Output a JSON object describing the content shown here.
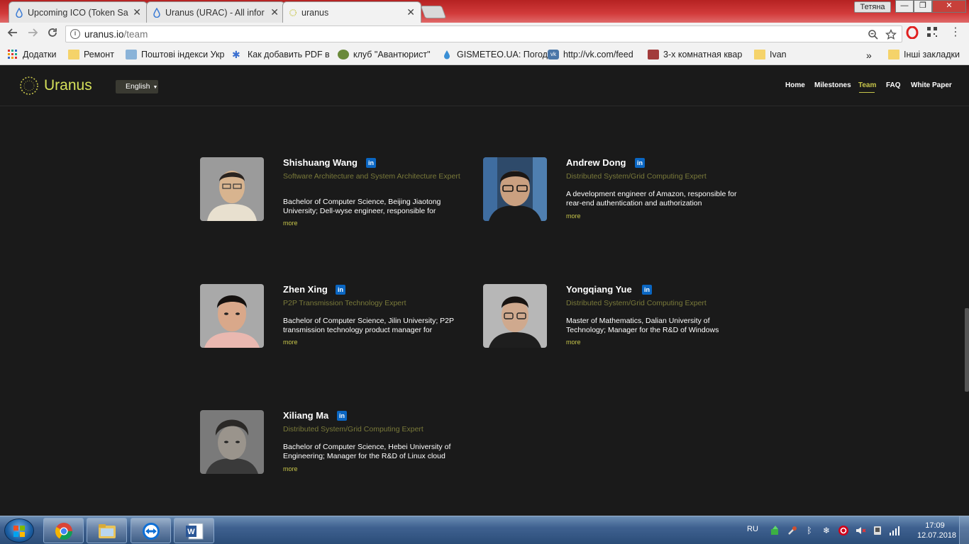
{
  "browser": {
    "tabs": [
      {
        "title": "Upcoming ICO (Token Sa",
        "close": "✕"
      },
      {
        "title": "Uranus (URAC) - All infor",
        "close": "✕"
      },
      {
        "title": "uranus",
        "close": "✕"
      }
    ],
    "user_badge": "Тетяна",
    "window_controls": {
      "minimize": "—",
      "maximize": "❐",
      "close": "✕"
    },
    "url_host": "uranus.io",
    "url_path": "/team",
    "bookmarks": [
      {
        "label": "Додатки"
      },
      {
        "label": "Ремонт"
      },
      {
        "label": "Поштові індекси Укр"
      },
      {
        "label": "Как добавить PDF в"
      },
      {
        "label": "клуб \"Авантюрист\""
      },
      {
        "label": "GISMETEO.UA: Погод"
      },
      {
        "label": "http://vk.com/feed"
      },
      {
        "label": "3-х комнатная квар"
      },
      {
        "label": "Ivan"
      },
      {
        "label": "Інші закладки"
      }
    ],
    "bookmarks_overflow": "»"
  },
  "site": {
    "logo": "Uranus",
    "language": "English",
    "nav": [
      {
        "label": "Home"
      },
      {
        "label": "Milestones"
      },
      {
        "label": "Team"
      },
      {
        "label": "FAQ"
      },
      {
        "label": "White Paper"
      }
    ],
    "active_nav": "Team"
  },
  "team": [
    {
      "name": "Shishuang Wang",
      "role": "Software Architecture and System Architecture Expert",
      "bio": "Bachelor of Computer Science, Beijing Jiaotong University; Dell-wyse engineer, responsible for",
      "more": "more",
      "linkedin": "in"
    },
    {
      "name": "Andrew Dong",
      "role": "Distributed System/Grid Computing Expert",
      "bio": "A development engineer of Amazon, responsible for rear-end authentication and authorization",
      "more": "more",
      "linkedin": "in"
    },
    {
      "name": "Zhen Xing",
      "role": "P2P Transmission Technology Expert",
      "bio": "Bachelor of Computer Science, Jilin University; P2P transmission technology product manager for",
      "more": "more",
      "linkedin": "in"
    },
    {
      "name": "Yongqiang Yue",
      "role": "Distributed System/Grid Computing Expert",
      "bio": "Master of Mathematics, Dalian University of Technology; Manager for the R&D of Windows",
      "more": "more",
      "linkedin": "in"
    },
    {
      "name": "Xiliang Ma",
      "role": "Distributed System/Grid Computing Expert",
      "bio": "Bachelor of Computer Science, Hebei University of Engineering; Manager for the R&D of Linux cloud",
      "more": "more",
      "linkedin": "in"
    }
  ],
  "taskbar": {
    "language": "RU",
    "time": "17:09",
    "date": "12.07.2018"
  }
}
